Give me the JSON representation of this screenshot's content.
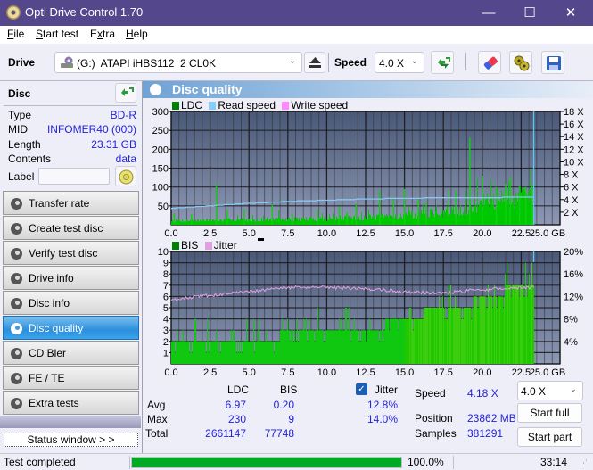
{
  "window": {
    "title": "Opti Drive Control 1.70",
    "minimize": "—",
    "maximize": "☐",
    "close": "✕"
  },
  "menu": [
    {
      "label": "File",
      "accel": "F",
      "rest": "ile"
    },
    {
      "label": "Start test",
      "accel": "S",
      "rest": "tart test"
    },
    {
      "label": "Extra",
      "accel": "x",
      "pre": "E",
      "rest": "tra"
    },
    {
      "label": "Help",
      "accel": "H",
      "rest": "elp"
    }
  ],
  "toolbar": {
    "drive_label": "Drive",
    "drive_value": "(G:)  ATAPI iHBS112  2 CL0K",
    "speed_label": "Speed",
    "speed_value": "4.0 X",
    "icons": [
      "drive-icon",
      "eject-icon",
      "refresh-icon",
      "erase-icon",
      "copy-icon",
      "save-icon"
    ]
  },
  "disc": {
    "header": "Disc",
    "rows": [
      {
        "key": "Type",
        "value": "BD-R"
      },
      {
        "key": "MID",
        "value": "INFOMER40 (000)"
      },
      {
        "key": "Length",
        "value": "23.31 GB"
      },
      {
        "key": "Contents",
        "value": "data"
      }
    ],
    "label_key": "Label",
    "label_value": ""
  },
  "nav": [
    {
      "label": "Transfer rate",
      "active": false
    },
    {
      "label": "Create test disc",
      "active": false
    },
    {
      "label": "Verify test disc",
      "active": false
    },
    {
      "label": "Drive info",
      "active": false
    },
    {
      "label": "Disc info",
      "active": false
    },
    {
      "label": "Disc quality",
      "active": true
    },
    {
      "label": "CD Bler",
      "active": false
    },
    {
      "label": "FE / TE",
      "active": false
    },
    {
      "label": "Extra tests",
      "active": false
    }
  ],
  "status_window_button": "Status window > >",
  "panel": {
    "title": "Disc quality"
  },
  "colors": {
    "plot_bg_top": "#4a5878",
    "plot_bg_bottom": "#8c98b4",
    "ldc": "#00c800",
    "bis": "#00c800",
    "read_speed": "#88c8f0",
    "write_speed": "#ff80ff",
    "jitter": "#e0a0e0",
    "progress": "#00aa22",
    "value_text": "#2323d8"
  },
  "chart_data": [
    {
      "type": "bar",
      "title": "LDC / Read speed",
      "legend": [
        {
          "name": "LDC",
          "color": "#008000"
        },
        {
          "name": "Read speed",
          "color": "#88ccf8"
        },
        {
          "name": "Write speed",
          "color": "#ff88ff"
        }
      ],
      "xlabel": "GB",
      "xlim": [
        0,
        25
      ],
      "xticks": [
        "0.0",
        "2.5",
        "5.0",
        "7.5",
        "10.0",
        "12.5",
        "15.0",
        "17.5",
        "20.0",
        "22.5",
        "25.0 GB"
      ],
      "ylim_left": [
        0,
        300
      ],
      "yticks_left": [
        "300",
        "250",
        "200",
        "150",
        "100",
        "50"
      ],
      "ylim_right": [
        0,
        18
      ],
      "yticks_right": [
        "18 X",
        "16 X",
        "14 X",
        "12 X",
        "10 X",
        "8 X",
        "6 X",
        "4 X",
        "2 X"
      ],
      "end_gb": 23.31,
      "series": [
        {
          "name": "LDC baseline",
          "x": [
            0,
            2.5,
            5,
            7.5,
            10,
            12.5,
            15,
            17.5,
            19,
            20,
            21,
            22,
            23.3
          ],
          "values": [
            12,
            12,
            14,
            15,
            17,
            20,
            25,
            35,
            45,
            60,
            70,
            75,
            78
          ]
        },
        {
          "name": "LDC spikes",
          "x": [
            0.2,
            1.3,
            2.9,
            3.6,
            4.7,
            6.5,
            7.8,
            9.4,
            10.8,
            11.3,
            11.9,
            13.4,
            14.3,
            15.0,
            15.9,
            16.4,
            18.3,
            19.2,
            20.0,
            20.9,
            21.5,
            21.8,
            22.4,
            22.8,
            23.2
          ],
          "values": [
            30,
            28,
            108,
            40,
            42,
            53,
            30,
            40,
            48,
            33,
            55,
            90,
            73,
            95,
            70,
            60,
            90,
            230,
            130,
            100,
            108,
            125,
            105,
            100,
            108
          ]
        },
        {
          "name": "Read speed",
          "x": [
            0,
            2.5,
            5,
            7.5,
            10,
            12.5,
            15,
            17.5,
            20,
            22.5,
            23.31
          ],
          "values": [
            2.6,
            3.0,
            3.4,
            3.7,
            3.9,
            4.1,
            4.2,
            4.3,
            4.3,
            4.4,
            4.4
          ]
        }
      ]
    },
    {
      "type": "bar",
      "title": "BIS / Jitter",
      "legend": [
        {
          "name": "BIS",
          "color": "#008000"
        },
        {
          "name": "Jitter",
          "color": "#e0a0e0"
        }
      ],
      "xlabel": "GB",
      "xlim": [
        0,
        25
      ],
      "xticks": [
        "0.0",
        "2.5",
        "5.0",
        "7.5",
        "10.0",
        "12.5",
        "15.0",
        "17.5",
        "20.0",
        "22.5",
        "25.0 GB"
      ],
      "ylim_left": [
        0,
        10
      ],
      "yticks_left": [
        "10",
        "9",
        "8",
        "7",
        "6",
        "5",
        "4",
        "3",
        "2",
        "1"
      ],
      "ylim_right": [
        0,
        20
      ],
      "yticks_right": [
        "20%",
        "16%",
        "12%",
        "8%",
        "4%"
      ],
      "end_gb": 23.31,
      "series": [
        {
          "name": "BIS level",
          "x": [
            0,
            6,
            8,
            12.5,
            15.0,
            17.5,
            19.0,
            20.0,
            21.0,
            22.0,
            23.3
          ],
          "values": [
            2,
            2,
            3,
            3,
            4,
            5,
            5,
            6,
            6,
            7,
            7
          ]
        },
        {
          "name": "Jitter",
          "x": [
            0,
            1,
            2.5,
            5,
            7.5,
            10,
            12.5,
            15,
            17.5,
            20,
            22.5,
            23.3
          ],
          "values": [
            11.4,
            11.8,
            12.2,
            12.8,
            13.6,
            13.6,
            13.4,
            12.8,
            12.6,
            13.2,
            13.6,
            13.6
          ]
        }
      ]
    }
  ],
  "stats": {
    "col_ldc": "LDC",
    "col_bis": "BIS",
    "jitter_label": "Jitter",
    "jitter_checked": true,
    "rows": [
      {
        "label": "Avg",
        "ldc": "6.97",
        "bis": "0.20",
        "jitter": "12.8%"
      },
      {
        "label": "Max",
        "ldc": "230",
        "bis": "9",
        "jitter": "14.0%"
      },
      {
        "label": "Total",
        "ldc": "2661147",
        "bis": "77748",
        "jitter": ""
      }
    ],
    "speed_label": "Speed",
    "speed_value": "4.18 X",
    "position_label": "Position",
    "position_value": "23862 MB",
    "samples_label": "Samples",
    "samples_value": "381291",
    "speed_select": "4.0 X",
    "start_full": "Start full",
    "start_part": "Start part"
  },
  "statusbar": {
    "text": "Test completed",
    "progress_percent": 100.0,
    "progress_text": "100.0%",
    "elapsed": "33:14"
  }
}
